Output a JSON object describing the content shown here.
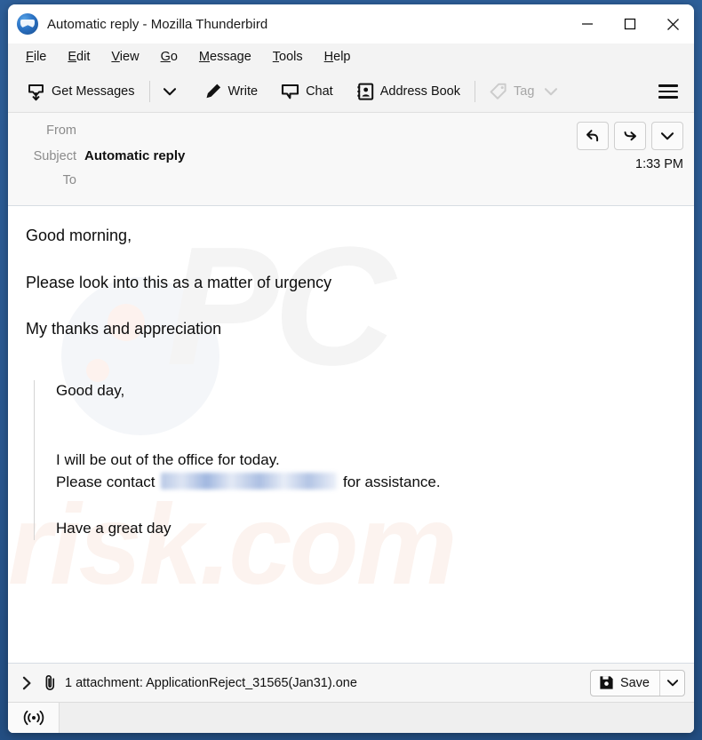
{
  "window": {
    "title": "Automatic reply - Mozilla Thunderbird",
    "logo_icon": "thunderbird-logo-icon",
    "controls": {
      "minimize": "minimize-icon",
      "maximize": "maximize-icon",
      "close": "close-icon"
    }
  },
  "menubar": {
    "items": [
      {
        "label": "File",
        "accesskey": "F",
        "rest": "ile"
      },
      {
        "label": "Edit",
        "accesskey": "E",
        "rest": "dit"
      },
      {
        "label": "View",
        "accesskey": "V",
        "rest": "iew"
      },
      {
        "label": "Go",
        "accesskey": "G",
        "rest": "o"
      },
      {
        "label": "Message",
        "accesskey": "M",
        "rest": "essage"
      },
      {
        "label": "Tools",
        "accesskey": "T",
        "rest": "ools"
      },
      {
        "label": "Help",
        "accesskey": "H",
        "rest": "elp"
      }
    ]
  },
  "toolbar": {
    "get_messages": "Get Messages",
    "get_messages_icon": "inbox-download-icon",
    "get_messages_chevron": "chevron-down-icon",
    "write": "Write",
    "write_icon": "pencil-icon",
    "chat": "Chat",
    "chat_icon": "speech-bubble-icon",
    "address_book": "Address Book",
    "address_book_icon": "address-book-icon",
    "tag": "Tag",
    "tag_icon": "tag-icon",
    "tag_chevron": "chevron-down-icon",
    "tag_disabled": true,
    "app_menu_icon": "hamburger-menu-icon"
  },
  "message_header": {
    "from_label": "From",
    "from_value": "",
    "subject_label": "Subject",
    "subject_value": "Automatic reply",
    "to_label": "To",
    "to_value": "",
    "time": "1:33 PM",
    "actions": {
      "reply": "reply-arrow-icon",
      "forward": "forward-arrow-icon",
      "more": "chevron-down-icon"
    }
  },
  "message_body": {
    "paragraphs": [
      "Good morning,",
      "Please look into this as a matter of urgency",
      "My thanks and appreciation"
    ],
    "quote": {
      "greeting": "Good day,",
      "line1": "I will be out of the office for today.",
      "line2_prefix": "Please contact",
      "line2_redacted": "",
      "line2_suffix": "for assistance.",
      "closing": "Have a great day"
    },
    "watermark_primary": "PC",
    "watermark_secondary": "risk.com"
  },
  "attachment": {
    "expand_icon": "chevron-right-icon",
    "clip_icon": "paperclip-icon",
    "text": "1 attachment: ApplicationReject_31565(Jan31).one",
    "save_label": "Save",
    "save_icon": "save-disk-icon",
    "save_chevron": "chevron-down-icon"
  },
  "statusbar": {
    "icon": "broadcast-signal-icon",
    "text": ""
  },
  "colors": {
    "desktop": "#2b5c96",
    "window": "#ffffff",
    "chrome": "#f3f3f3",
    "header": "#f8f8f8",
    "muted_text": "#8b8b8b"
  }
}
